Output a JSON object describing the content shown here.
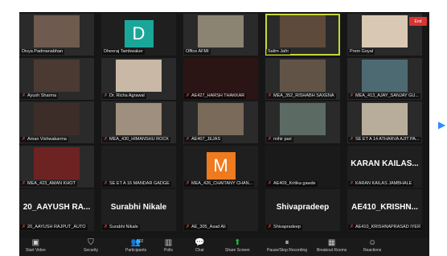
{
  "tiles": [
    {
      "name": "Divya Padmanabhan",
      "type": "video",
      "photo": "#6e5a4e",
      "muted": false
    },
    {
      "name": "Dheeraj Tambwaker",
      "type": "avatar",
      "letter": "D",
      "avatar_color": "#1aa79a",
      "muted": false
    },
    {
      "name": "Office AFMI",
      "type": "video",
      "photo": "#8c8473",
      "muted": false
    },
    {
      "name": "Salim Jafri",
      "type": "video",
      "photo": "#5e4a3a",
      "muted": false,
      "active": true
    },
    {
      "name": "Prem Goyal",
      "type": "video",
      "photo": "#d9c9b4",
      "muted": false
    },
    {
      "name": "Ayush Sharma",
      "type": "video",
      "photo": "#4a3a32",
      "muted": true
    },
    {
      "name": "Dr. Richa Agrawal",
      "type": "video",
      "photo": "#c9b8a6",
      "muted": true
    },
    {
      "name": "AE427_HARSH THAKKAR",
      "type": "video",
      "photo": "#2b1414",
      "muted": true,
      "wide": true
    },
    {
      "name": "MEA_352_RISHABH SAXENA",
      "type": "video",
      "photo": "#615447",
      "muted": true
    },
    {
      "name": "MEA_413_AJAY_SANJAY GU...",
      "type": "video",
      "photo": "#4d6a73",
      "muted": true
    },
    {
      "name": "Aman Vishwakarma",
      "type": "video",
      "photo": "#3d2d28",
      "muted": true
    },
    {
      "name": "MEA_430_HIMANSHU ROCK",
      "type": "video",
      "photo": "#9f8f7e",
      "muted": true
    },
    {
      "name": "AE407_JEJAS",
      "type": "video",
      "photo": "#7a6a5a",
      "muted": true
    },
    {
      "name": "mihir pari",
      "type": "video",
      "photo": "#5b6b64",
      "muted": true
    },
    {
      "name": "SE ET A 14 ATHARVA AJIT PA...",
      "type": "video",
      "photo": "#b8ad9a",
      "muted": true
    },
    {
      "name": "MEA_423_AMAN KHOT",
      "type": "video",
      "photo": "#6e2323",
      "muted": true
    },
    {
      "name": "SE ET A 16 MANDAR GADGE",
      "type": "blank",
      "muted": true
    },
    {
      "name": "MEA_426_CHAITANY CHAN...",
      "type": "avatar",
      "letter": "M",
      "avatar_color": "#ee7b1f",
      "muted": true
    },
    {
      "name": "AE409_Kritika gawde",
      "type": "video",
      "photo": "#1a1a1a",
      "muted": true,
      "wide": true
    },
    {
      "name": "KARAN KAILAS JAMBHALE",
      "type": "text",
      "big": "KARAN  KAILAS...",
      "muted": true
    },
    {
      "name": "20_AAYUSH RAJPUT_AUTO",
      "type": "text",
      "big": "20_AAYUSH  RA...",
      "muted": true
    },
    {
      "name": "Surabhi Nikale",
      "type": "text",
      "big": "Surabhi Nikale",
      "muted": true
    },
    {
      "name": "AE_305_Asad Ali",
      "type": "blank",
      "muted": true
    },
    {
      "name": "Shivapradeep",
      "type": "text",
      "big": "Shivapradeep",
      "muted": true
    },
    {
      "name": "AE410_KRISHNAPRASAD IYER",
      "type": "text",
      "big": "AE410_KRISHN...",
      "muted": true
    }
  ],
  "toolbar": [
    {
      "label": "Start Video",
      "icon": "video-icon",
      "glyph": "▣"
    },
    {
      "label": "Security",
      "icon": "shield-icon",
      "glyph": "⛉"
    },
    {
      "label": "Participants",
      "icon": "participants-icon",
      "glyph": "👥",
      "count": "102"
    },
    {
      "label": "Polls",
      "icon": "polls-icon",
      "glyph": "▥"
    },
    {
      "label": "Chat",
      "icon": "chat-icon",
      "glyph": "💬"
    },
    {
      "label": "Share Screen",
      "icon": "share-screen-icon",
      "glyph": "⬆",
      "green": true
    },
    {
      "label": "Pause/Stop Recording",
      "icon": "recording-icon",
      "glyph": "⏸"
    },
    {
      "label": "Breakout Rooms",
      "icon": "breakout-rooms-icon",
      "glyph": "▦"
    },
    {
      "label": "Reactions",
      "icon": "reactions-icon",
      "glyph": "☺"
    }
  ],
  "end_label": "End",
  "next_page_glyph": "▶"
}
